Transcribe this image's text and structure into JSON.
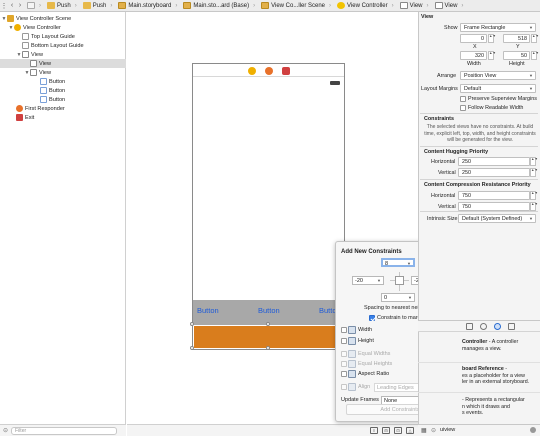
{
  "breadcrumb": [
    {
      "label": "",
      "icon": "file-icon"
    },
    {
      "label": "Push",
      "icon": "folder-icon"
    },
    {
      "label": "Push",
      "icon": "folder-icon"
    },
    {
      "label": "Main.storyboard",
      "icon": "storyboard-icon"
    },
    {
      "label": "Main.sto...ard (Base)",
      "icon": "storyboard-icon"
    },
    {
      "label": "View Co...ller Scene",
      "icon": "scene-icon"
    },
    {
      "label": "View Controller",
      "icon": "view-controller-icon"
    },
    {
      "label": "View",
      "icon": "view-icon"
    },
    {
      "label": "View",
      "icon": "view-icon"
    },
    {
      "label": "View",
      "icon": "view-icon"
    }
  ],
  "outline": {
    "scene": "View Controller Scene",
    "view_controller": "View Controller",
    "top_layout_guide": "Top Layout Guide",
    "bottom_layout_guide": "Bottom Layout Guide",
    "view": "View",
    "subview_selected": "View",
    "subview": "View",
    "button1": "Button",
    "button2": "Button",
    "button3": "Button",
    "first_responder": "First Responder",
    "exit": "Exit",
    "filter_placeholder": "Filter"
  },
  "canvas": {
    "buttons": [
      "Button",
      "Button",
      "Button"
    ]
  },
  "constraints_popover": {
    "title": "Add New Constraints",
    "top_value": "8",
    "left_value": "-20",
    "right_value": "-20",
    "bottom_value": "0",
    "spacing_label": "Spacing to nearest neighbor",
    "constrain_margins_label": "Constrain to margins",
    "width_label": "Width",
    "width_value": "320",
    "height_label": "Height",
    "height_value": "50",
    "equal_widths_label": "Equal Widths",
    "equal_heights_label": "Equal Heights",
    "aspect_ratio_label": "Aspect Ratio",
    "align_label": "Align",
    "align_value": "Leading Edges",
    "update_frames_label": "Update Frames",
    "update_frames_value": "None",
    "add_button": "Add Constraints"
  },
  "inspector": {
    "header": "View",
    "show_label": "Show",
    "show_value": "Frame Rectangle",
    "x_value": "0",
    "y_value": "518",
    "width_value": "320",
    "height_value": "50",
    "x_label": "X",
    "y_label": "Y",
    "width_label": "Width",
    "height_label": "Height",
    "arrange_label": "Arrange",
    "arrange_value": "Position View",
    "layout_margins_label": "Layout Margins",
    "layout_margins_value": "Default",
    "preserve_margins_label": "Preserve Superview Margins",
    "follow_readable_label": "Follow Readable Width",
    "constraints_heading": "Constraints",
    "constraints_note": "The selected views have no constraints. At build time, explicit left, top, width, and height constraints will be generated for the view.",
    "hugging_heading": "Content Hugging Priority",
    "horizontal_label": "Horizontal",
    "vertical_label": "Vertical",
    "hug_h": "250",
    "hug_v": "250",
    "compression_heading": "Content Compression Resistance Priority",
    "comp_h": "750",
    "comp_v": "750",
    "intrinsic_label": "Intrinsic Size",
    "intrinsic_value": "Default (System Defined)"
  },
  "library": {
    "item1_title": "Controller",
    "item1_desc": " - A controller",
    "item1_desc2": "manages a view.",
    "item2_title": "board Reference",
    "item2_desc": " -",
    "item2_desc2": "es a placeholder for a view",
    "item2_desc3": "ler in an external storyboard.",
    "item3_desc": " - Represents a rectangular",
    "item3_desc2": "n which it draws and",
    "item3_desc3": "s events.",
    "search_value": "uiview"
  },
  "colors": {
    "accent": "#1e5bd8",
    "selection_bar": "#a8a8a8",
    "orange_view": "#d97d1d"
  }
}
